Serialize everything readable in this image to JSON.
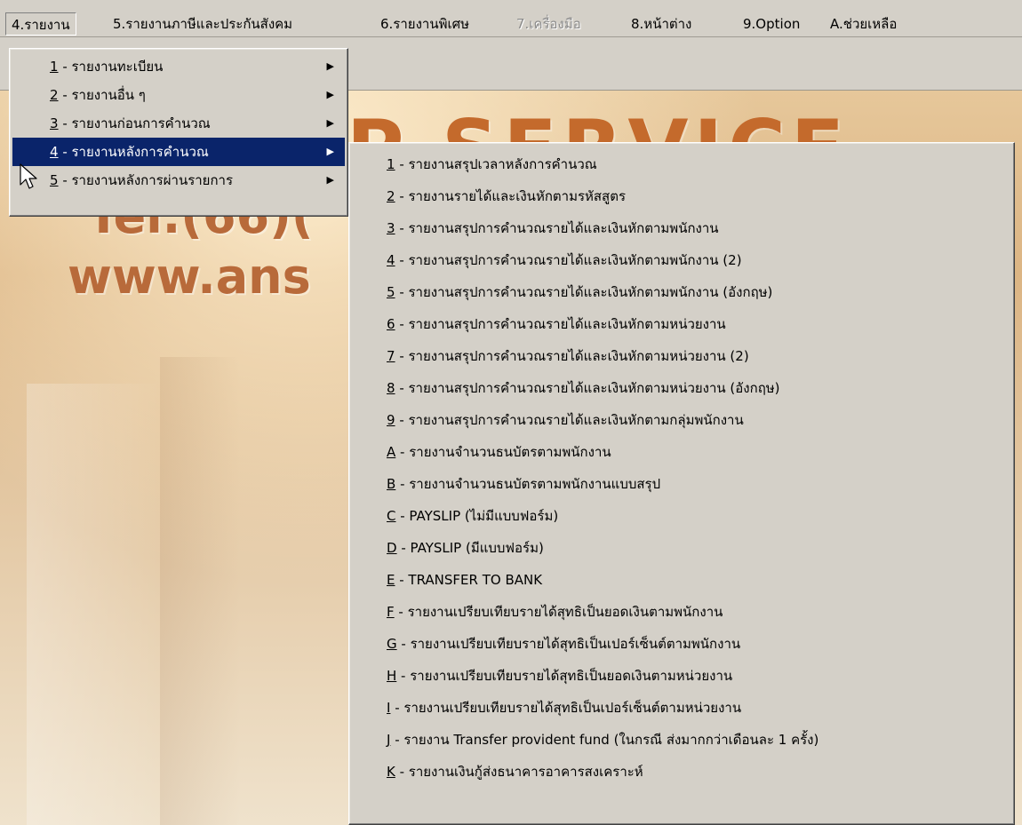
{
  "menubar": {
    "items": [
      {
        "label": "4.รายงาน",
        "state": "active"
      },
      {
        "label": "5.รายงานภาษีและประกันสังคม",
        "state": "normal"
      },
      {
        "label": "6.รายงานพิเศษ",
        "state": "normal"
      },
      {
        "label": "7.เครื่องมือ",
        "state": "disabled"
      },
      {
        "label": "8.หน้าต่าง",
        "state": "normal"
      },
      {
        "label": "9.Option",
        "state": "normal"
      },
      {
        "label": "A.ช่วยเหลือ",
        "state": "normal"
      }
    ]
  },
  "banner": {
    "line1": "P SERVICE",
    "line2": "Tel.(66)(",
    "line3": "www.ans"
  },
  "report_menu": {
    "items": [
      {
        "key": "1",
        "label": " - รายงานทะเบียน",
        "has_submenu": true
      },
      {
        "key": "2",
        "label": " - รายงานอื่น ๆ",
        "has_submenu": true
      },
      {
        "key": "3",
        "label": " - รายงานก่อนการคำนวณ",
        "has_submenu": true
      },
      {
        "key": "4",
        "label": " - รายงานหลังการคำนวณ",
        "has_submenu": true,
        "highlighted": true
      },
      {
        "key": "5",
        "label": " - รายงานหลังการผ่านรายการ",
        "has_submenu": true
      }
    ]
  },
  "after_calc_menu": {
    "items": [
      {
        "key": "1",
        "label": " - รายงานสรุปเวลาหลังการคำนวณ"
      },
      {
        "key": "2",
        "label": " - รายงานรายได้และเงินหักตามรหัสสูตร"
      },
      {
        "key": "3",
        "label": " - รายงานสรุปการคำนวณรายได้และเงินหักตามพนักงาน"
      },
      {
        "key": "4",
        "label": " - รายงานสรุปการคำนวณรายได้และเงินหักตามพนักงาน (2)"
      },
      {
        "key": "5",
        "label": " - รายงานสรุปการคำนวณรายได้และเงินหักตามพนักงาน (อังกฤษ)"
      },
      {
        "key": "6",
        "label": " - รายงานสรุปการคำนวณรายได้และเงินหักตามหน่วยงาน"
      },
      {
        "key": "7",
        "label": " - รายงานสรุปการคำนวณรายได้และเงินหักตามหน่วยงาน (2)"
      },
      {
        "key": "8",
        "label": " - รายงานสรุปการคำนวณรายได้และเงินหักตามหน่วยงาน (อังกฤษ)"
      },
      {
        "key": "9",
        "label": " - รายงานสรุปการคำนวณรายได้และเงินหักตามกลุ่มพนักงาน"
      },
      {
        "key": "A",
        "label": " - รายงานจำนวนธนบัตรตามพนักงาน"
      },
      {
        "key": "B",
        "label": " - รายงานจำนวนธนบัตรตามพนักงานแบบสรุป"
      },
      {
        "key": "C",
        "label": " - PAYSLIP (ไม่มีแบบฟอร์ม)"
      },
      {
        "key": "D",
        "label": " - PAYSLIP (มีแบบฟอร์ม)"
      },
      {
        "key": "E",
        "label": " - TRANSFER TO BANK"
      },
      {
        "key": "F",
        "label": " - รายงานเปรียบเทียบรายได้สุทธิเป็นยอดเงินตามพนักงาน"
      },
      {
        "key": "G",
        "label": " - รายงานเปรียบเทียบรายได้สุทธิเป็นเปอร์เซ็นต์ตามพนักงาน"
      },
      {
        "key": "H",
        "label": " - รายงานเปรียบเทียบรายได้สุทธิเป็นยอดเงินตามหน่วยงาน"
      },
      {
        "key": "I",
        "label": " - รายงานเปรียบเทียบรายได้สุทธิเป็นเปอร์เซ็นต์ตามหน่วยงาน"
      },
      {
        "key": "J",
        "label": " - รายงาน Transfer provident fund (ในกรณี ส่งมากกว่าเดือนละ 1 ครั้ง)"
      },
      {
        "key": "K",
        "label": " - รายงานเงินกู้ส่งธนาคารอาคารสงเคราะห์"
      }
    ]
  },
  "colors": {
    "menu_face": "#d4d0c8",
    "highlight": "#0a246a",
    "highlight_text": "#ffffff",
    "banner_text": "#c46a2c"
  },
  "icons": {
    "submenu_arrow": "triangle-right-icon",
    "cursor": "mouse-pointer-icon"
  }
}
